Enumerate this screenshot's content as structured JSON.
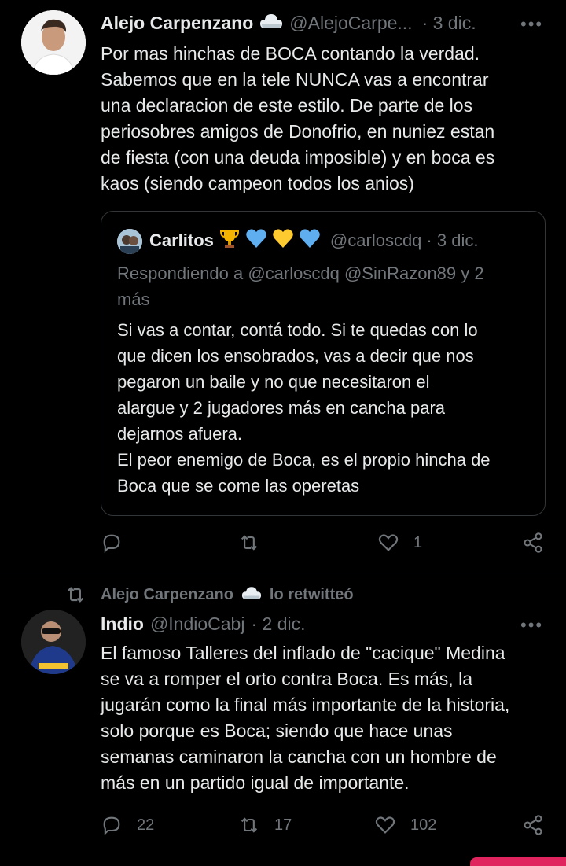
{
  "tweet1": {
    "name": "Alejo Carpenzano",
    "handle": "@AlejoCarpe...",
    "time": "· 3 dic.",
    "more": "•••",
    "text": "Por mas hinchas de BOCA contando la verdad.\nSabemos que en la tele NUNCA vas a encontrar\nuna declaracion de este estilo. De parte de los\nperiosobres amigos de Donofrio, en nuniez estan\nde fiesta (con una deuda imposible) y en boca es\nkaos (siendo campeon todos los anios)",
    "quote": {
      "name": "Carlitos",
      "handle": "@carloscdq",
      "time": "· 3 dic.",
      "replying": "Respondiendo a @carloscdq @SinRazon89 y 2\nmás",
      "text": "Si vas a contar, contá todo. Si te quedas con lo\nque dicen los ensobrados, vas a decir que nos\npegaron un baile y no que necesitaron el\nalargue y 2 jugadores más en cancha para\ndejarnos afuera.\nEl peor enemigo de Boca, es el propio hincha de\nBoca que se come las operetas"
    },
    "actions": {
      "replies": "",
      "retweets": "",
      "likes": "1"
    }
  },
  "retweet_banner": {
    "text": "Alejo Carpenzano",
    "suffix": "lo retwitteó"
  },
  "tweet2": {
    "name": "Indio",
    "handle": "@IndioCabj",
    "time": "· 2 dic.",
    "more": "•••",
    "text": "El famoso Talleres del inflado de \"cacique\" Medina\nse va a romper el orto contra Boca. Es más, la\njugarán como la final más importante de la historia,\nsolo porque es Boca; siendo que hace unas\nsemanas caminaron la cancha con un hombre de\nmás en un partido igual de importante.",
    "actions": {
      "replies": "22",
      "retweets": "17",
      "likes": "102"
    }
  },
  "colors": {
    "background": "#000000",
    "text": "#e7e9ea",
    "muted": "#71767b",
    "border": "#2f3336",
    "gold": "#f4b400",
    "blue": "#5eaef0"
  },
  "icons": [
    "cloud-icon",
    "trophy-icon",
    "blue-heart-icon",
    "yellow-heart-icon",
    "reply-icon",
    "retweet-icon",
    "like-icon",
    "share-icon"
  ]
}
